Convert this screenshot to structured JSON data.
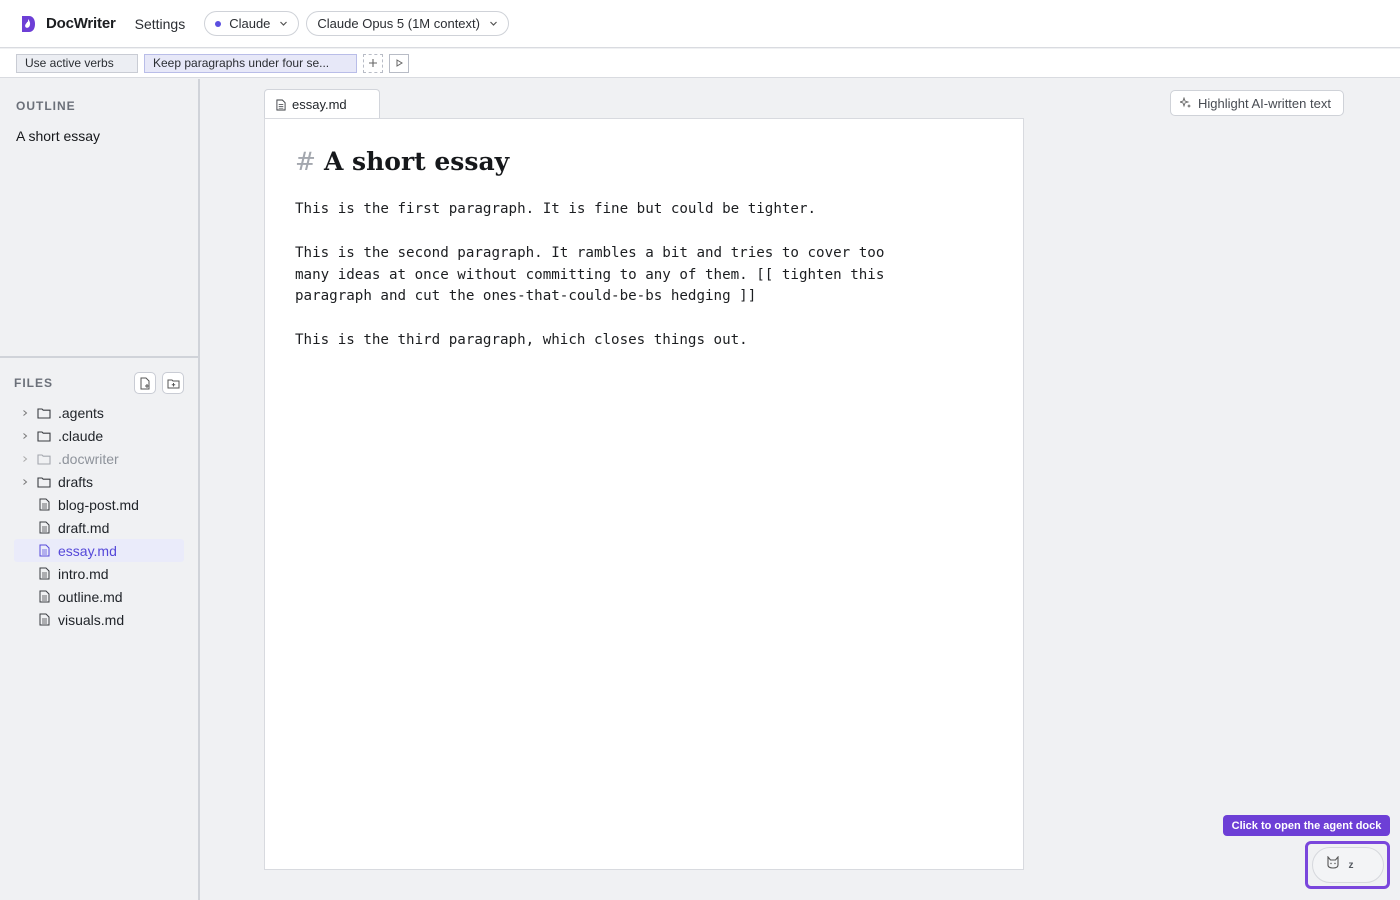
{
  "app": {
    "name": "DocWriter",
    "settings_label": "Settings",
    "provider": "Claude",
    "model": "Claude Opus 5 (1M context)",
    "accent_color": "#5b4fe0"
  },
  "rules": {
    "items": [
      "Use active verbs",
      "Keep paragraphs under four se..."
    ]
  },
  "outline": {
    "title": "OUTLINE",
    "items": [
      "A short essay"
    ]
  },
  "files": {
    "title": "FILES",
    "tree": [
      {
        "name": ".agents",
        "type": "folder"
      },
      {
        "name": ".claude",
        "type": "folder"
      },
      {
        "name": ".docwriter",
        "type": "folder",
        "muted": true
      },
      {
        "name": "drafts",
        "type": "folder"
      },
      {
        "name": "blog-post.md",
        "type": "file"
      },
      {
        "name": "draft.md",
        "type": "file"
      },
      {
        "name": "essay.md",
        "type": "file",
        "active": true
      },
      {
        "name": "intro.md",
        "type": "file"
      },
      {
        "name": "outline.md",
        "type": "file"
      },
      {
        "name": "visuals.md",
        "type": "file"
      }
    ]
  },
  "editor": {
    "tab_label": "essay.md",
    "highlight_label": "Highlight AI-written text",
    "heading_marker": "#",
    "title": "A short essay",
    "paragraphs": [
      "This is the first paragraph. It is fine but could be tighter.",
      "This is the second paragraph. It rambles a bit and tries to cover too\nmany ideas at once without committing to any of them. [[ tighten this\nparagraph and cut the ones-that-could-be-bs hedging ]]",
      "This is the third paragraph, which closes things out."
    ]
  },
  "dock": {
    "tooltip": "Click to open the agent dock",
    "status": "z"
  }
}
